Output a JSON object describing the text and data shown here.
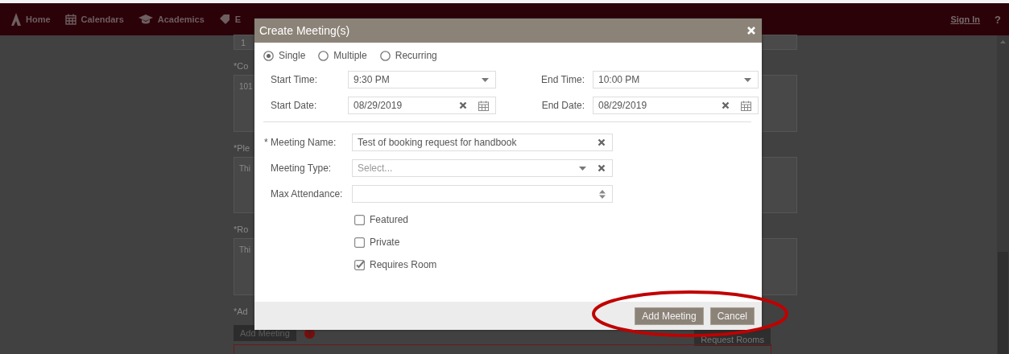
{
  "nav": {
    "items": [
      {
        "label": "Home"
      },
      {
        "label": "Calendars"
      },
      {
        "label": "Academics"
      },
      {
        "label": "E"
      }
    ],
    "sign_in": "Sign In",
    "help": "?"
  },
  "page": {
    "items": [
      {
        "kind": "input",
        "text": "1"
      },
      {
        "kind": "label",
        "text": "*Co"
      },
      {
        "kind": "textarea",
        "text": "101"
      },
      {
        "kind": "label",
        "text": "*Ple"
      },
      {
        "kind": "textarea",
        "text": "Thi"
      },
      {
        "kind": "label",
        "text": "*Ro"
      },
      {
        "kind": "textarea",
        "text": "Thi"
      },
      {
        "kind": "label",
        "text": "*Ad"
      }
    ],
    "add_button": "Add Meeting",
    "request_button": "Request Rooms"
  },
  "dialog": {
    "title": "Create Meeting(s)",
    "modes": [
      {
        "label": "Single",
        "selected": true
      },
      {
        "label": "Multiple",
        "selected": false
      },
      {
        "label": "Recurring",
        "selected": false
      }
    ],
    "schedule": [
      {
        "label": "Start Time:",
        "kind": "select",
        "value": "9:30 PM"
      },
      {
        "label": "End Time:",
        "kind": "select",
        "value": "10:00 PM"
      },
      {
        "label": "Start Date:",
        "kind": "date",
        "value": "08/29/2019"
      },
      {
        "label": "End Date:",
        "kind": "date",
        "value": "08/29/2019"
      }
    ],
    "fields": [
      {
        "label": "Meeting Name:",
        "required_mark": "*",
        "kind": "text",
        "value": "Test of booking request for handbook"
      },
      {
        "label": "Meeting Type:",
        "kind": "select",
        "placeholder": "Select..."
      },
      {
        "label": "Max Attendance:",
        "kind": "number"
      }
    ],
    "checkboxes": [
      {
        "label": "Featured",
        "checked": false
      },
      {
        "label": "Private",
        "checked": false
      },
      {
        "label": "Requires Room",
        "checked": true
      }
    ],
    "buttons": [
      {
        "label": "Add Meeting"
      },
      {
        "label": "Cancel"
      }
    ]
  }
}
